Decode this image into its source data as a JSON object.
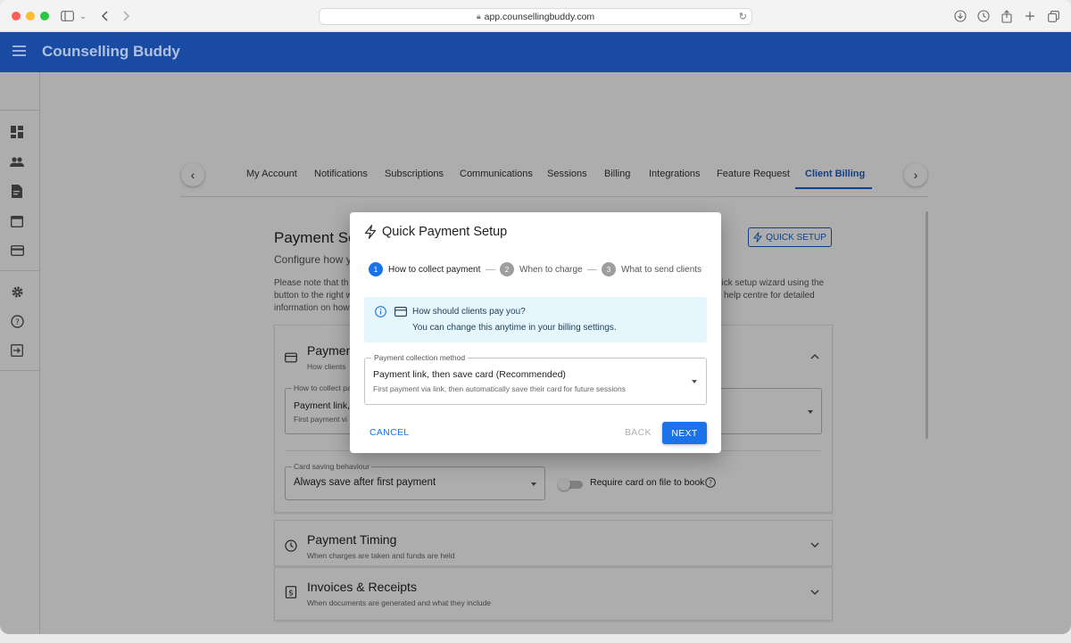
{
  "browser": {
    "url": "app.counsellingbuddy.com"
  },
  "app": {
    "title": "Counselling Buddy"
  },
  "tabs": [
    {
      "label": "My Account"
    },
    {
      "label": "Notifications"
    },
    {
      "label": "Subscriptions"
    },
    {
      "label": "Communications"
    },
    {
      "label": "Sessions"
    },
    {
      "label": "Billing"
    },
    {
      "label": "Integrations"
    },
    {
      "label": "Feature Request"
    },
    {
      "label": "Client Billing",
      "active": true
    }
  ],
  "page": {
    "title": "Payment Se",
    "subtitle": "Configure how yo",
    "note_left_1": "Please note that th",
    "note_left_2": "button to the right w",
    "note_left_3": "information on how",
    "note_right_1": "uick setup wizard using the",
    "note_right_2": "help centre for detailed",
    "quick_setup_label": "QUICK SETUP"
  },
  "panels": {
    "payment": {
      "title": "Paymen",
      "subtitle": "How clients",
      "collect_label": "How to collect pa",
      "collect_value": "Payment link, t",
      "collect_help": "First payment vi",
      "card_saving_label": "Card saving behaviour",
      "card_saving_value": "Always save after first payment",
      "require_card_label": "Require card on file to book"
    },
    "timing": {
      "title": "Payment Timing",
      "subtitle": "When charges are taken and funds are held"
    },
    "invoices": {
      "title": "Invoices & Receipts",
      "subtitle": "When documents are generated and what they include"
    }
  },
  "dialog": {
    "title": "Quick Payment Setup",
    "steps": [
      {
        "number": "1",
        "label": "How to collect payment",
        "active": true
      },
      {
        "number": "2",
        "label": "When to charge",
        "active": false
      },
      {
        "number": "3",
        "label": "What to send clients",
        "active": false
      }
    ],
    "info": {
      "title": "How should clients pay you?",
      "text": "You can change this anytime in your billing settings."
    },
    "select": {
      "label": "Payment collection method",
      "value": "Payment link, then save card (Recommended)",
      "help": "First payment via link, then automatically save their card for future sessions"
    },
    "buttons": {
      "cancel": "CANCEL",
      "back": "BACK",
      "next": "NEXT"
    }
  },
  "colors": {
    "brand": "#1a4ba3",
    "accent": "#1a73e8",
    "info_bg": "#e5f6fd"
  }
}
